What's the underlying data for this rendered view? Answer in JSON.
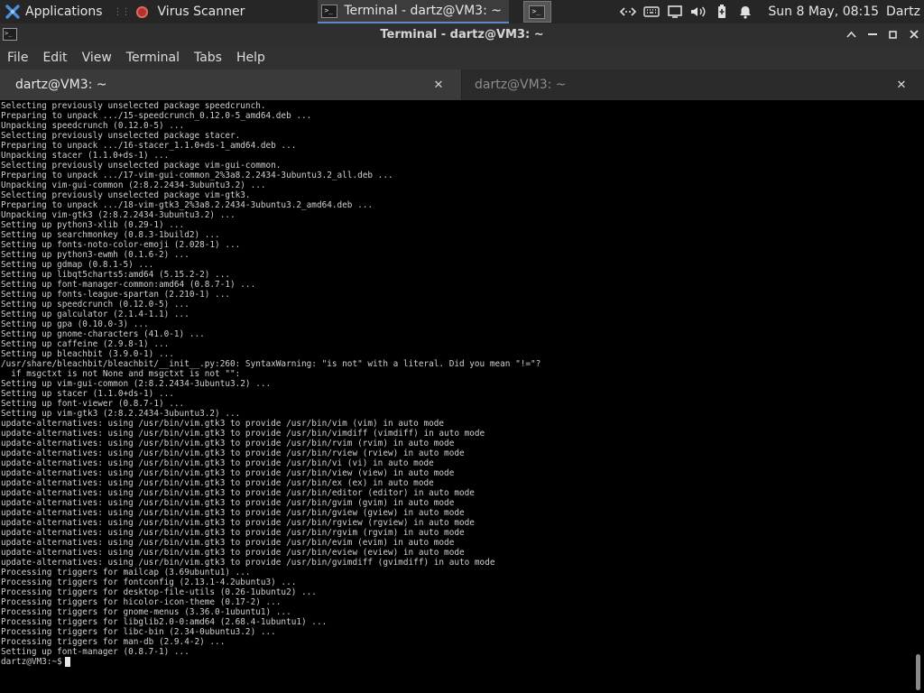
{
  "panel": {
    "applications_label": "Applications",
    "tasks": [
      {
        "label": "Virus Scanner"
      },
      {
        "label": "Terminal - dartz@VM3: ~"
      }
    ],
    "terminal_mini": ">_",
    "clock": "Sun  8 May, 08:15",
    "user": "Dartz",
    "tray": {
      "network": "‹·›",
      "bell": "🔔",
      "volume": "🔊"
    }
  },
  "window": {
    "title": "Terminal - dartz@VM3: ~",
    "icon_glyph": ">_"
  },
  "menu": {
    "items": [
      "File",
      "Edit",
      "View",
      "Terminal",
      "Tabs",
      "Help"
    ]
  },
  "tabs": [
    {
      "label": "dartz@VM3: ~",
      "close": "✕"
    },
    {
      "label": "dartz@VM3: ~",
      "close": "✕"
    }
  ],
  "terminal": {
    "lines": [
      "Selecting previously unselected package speedcrunch.",
      "Preparing to unpack .../15-speedcrunch_0.12.0-5_amd64.deb ...",
      "Unpacking speedcrunch (0.12.0-5) ...",
      "Selecting previously unselected package stacer.",
      "Preparing to unpack .../16-stacer_1.1.0+ds-1_amd64.deb ...",
      "Unpacking stacer (1.1.0+ds-1) ...",
      "Selecting previously unselected package vim-gui-common.",
      "Preparing to unpack .../17-vim-gui-common_2%3a8.2.2434-3ubuntu3.2_all.deb ...",
      "Unpacking vim-gui-common (2:8.2.2434-3ubuntu3.2) ...",
      "Selecting previously unselected package vim-gtk3.",
      "Preparing to unpack .../18-vim-gtk3_2%3a8.2.2434-3ubuntu3.2_amd64.deb ...",
      "Unpacking vim-gtk3 (2:8.2.2434-3ubuntu3.2) ...",
      "Setting up python3-xlib (0.29-1) ...",
      "Setting up searchmonkey (0.8.3-1build2) ...",
      "Setting up fonts-noto-color-emoji (2.028-1) ...",
      "Setting up python3-ewmh (0.1.6-2) ...",
      "Setting up gdmap (0.8.1-5) ...",
      "Setting up libqt5charts5:amd64 (5.15.2-2) ...",
      "Setting up font-manager-common:amd64 (0.8.7-1) ...",
      "Setting up fonts-league-spartan (2.210-1) ...",
      "Setting up speedcrunch (0.12.0-5) ...",
      "Setting up galculator (2.1.4-1.1) ...",
      "Setting up gpa (0.10.0-3) ...",
      "Setting up gnome-characters (41.0-1) ...",
      "Setting up caffeine (2.9.8-1) ...",
      "Setting up bleachbit (3.9.0-1) ...",
      "/usr/share/bleachbit/bleachbit/__init__.py:260: SyntaxWarning: \"is not\" with a literal. Did you mean \"!=\"?",
      "  if msgctxt is not None and msgctxt is not \"\":",
      "Setting up vim-gui-common (2:8.2.2434-3ubuntu3.2) ...",
      "Setting up stacer (1.1.0+ds-1) ...",
      "Setting up font-viewer (0.8.7-1) ...",
      "Setting up vim-gtk3 (2:8.2.2434-3ubuntu3.2) ...",
      "update-alternatives: using /usr/bin/vim.gtk3 to provide /usr/bin/vim (vim) in auto mode",
      "update-alternatives: using /usr/bin/vim.gtk3 to provide /usr/bin/vimdiff (vimdiff) in auto mode",
      "update-alternatives: using /usr/bin/vim.gtk3 to provide /usr/bin/rvim (rvim) in auto mode",
      "update-alternatives: using /usr/bin/vim.gtk3 to provide /usr/bin/rview (rview) in auto mode",
      "update-alternatives: using /usr/bin/vim.gtk3 to provide /usr/bin/vi (vi) in auto mode",
      "update-alternatives: using /usr/bin/vim.gtk3 to provide /usr/bin/view (view) in auto mode",
      "update-alternatives: using /usr/bin/vim.gtk3 to provide /usr/bin/ex (ex) in auto mode",
      "update-alternatives: using /usr/bin/vim.gtk3 to provide /usr/bin/editor (editor) in auto mode",
      "update-alternatives: using /usr/bin/vim.gtk3 to provide /usr/bin/gvim (gvim) in auto mode",
      "update-alternatives: using /usr/bin/vim.gtk3 to provide /usr/bin/gview (gview) in auto mode",
      "update-alternatives: using /usr/bin/vim.gtk3 to provide /usr/bin/rgview (rgview) in auto mode",
      "update-alternatives: using /usr/bin/vim.gtk3 to provide /usr/bin/rgvim (rgvim) in auto mode",
      "update-alternatives: using /usr/bin/vim.gtk3 to provide /usr/bin/evim (evim) in auto mode",
      "update-alternatives: using /usr/bin/vim.gtk3 to provide /usr/bin/eview (eview) in auto mode",
      "update-alternatives: using /usr/bin/vim.gtk3 to provide /usr/bin/gvimdiff (gvimdiff) in auto mode",
      "Processing triggers for mailcap (3.69ubuntu1) ...",
      "Processing triggers for fontconfig (2.13.1-4.2ubuntu3) ...",
      "Processing triggers for desktop-file-utils (0.26-1ubuntu2) ...",
      "Processing triggers for hicolor-icon-theme (0.17-2) ...",
      "Processing triggers for gnome-menus (3.36.0-1ubuntu1) ...",
      "Processing triggers for libglib2.0-0:amd64 (2.68.4-1ubuntu1) ...",
      "Processing triggers for libc-bin (2.34-0ubuntu3.2) ...",
      "Processing triggers for man-db (2.9.4-2) ...",
      "Setting up font-manager (0.8.7-1) ..."
    ],
    "prompt": "dartz@VM3:~$"
  }
}
